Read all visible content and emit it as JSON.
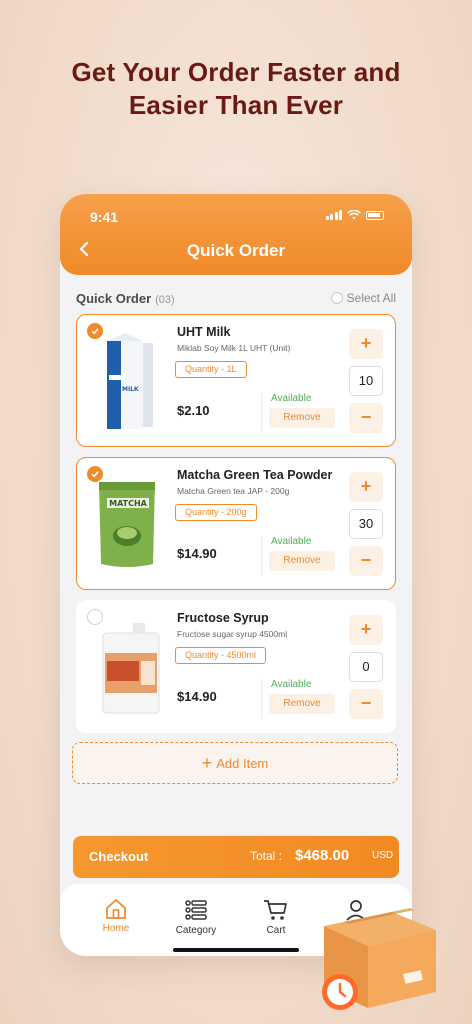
{
  "headline": {
    "line1": "Get Your Order Faster and",
    "line2": "Easier Than Ever"
  },
  "status_bar": {
    "time": "9:41"
  },
  "header": {
    "title": "Quick Order"
  },
  "list": {
    "label": "Quick Order",
    "count": "(03)",
    "select_all": "Select All"
  },
  "items": [
    {
      "name": "UHT Milk",
      "description": "Miklab Soy Milk 1L UHT (Unit)",
      "quantity_tag": "Quantity - 1L",
      "price": "$2.10",
      "availability": "Available",
      "remove": "Remove",
      "quantity": "10",
      "selected": true,
      "image_label": "MILK"
    },
    {
      "name": "Matcha Green Tea Powder",
      "description": "Matcha Green tea JAP - 200g",
      "quantity_tag": "Quantity - 200g",
      "price": "$14.90",
      "availability": "Available",
      "remove": "Remove",
      "quantity": "30",
      "selected": true,
      "image_label": "MATCHA"
    },
    {
      "name": "Fructose Syrup",
      "description": "Fructose sugar syrup 4500ml",
      "quantity_tag": "Quantity - 4500ml",
      "price": "$14.90",
      "availability": "Available",
      "remove": "Remove",
      "quantity": "0",
      "selected": false
    }
  ],
  "add_item": "Add Item",
  "checkout": {
    "label": "Checkout",
    "total_label": "Total :",
    "total_amount": "$468.00",
    "currency": "USD"
  },
  "nav": {
    "home": "Home",
    "category": "Category",
    "cart": "Cart"
  },
  "colors": {
    "accent": "#f08a2a",
    "headline": "#6a1a12",
    "available": "#4caf50"
  }
}
